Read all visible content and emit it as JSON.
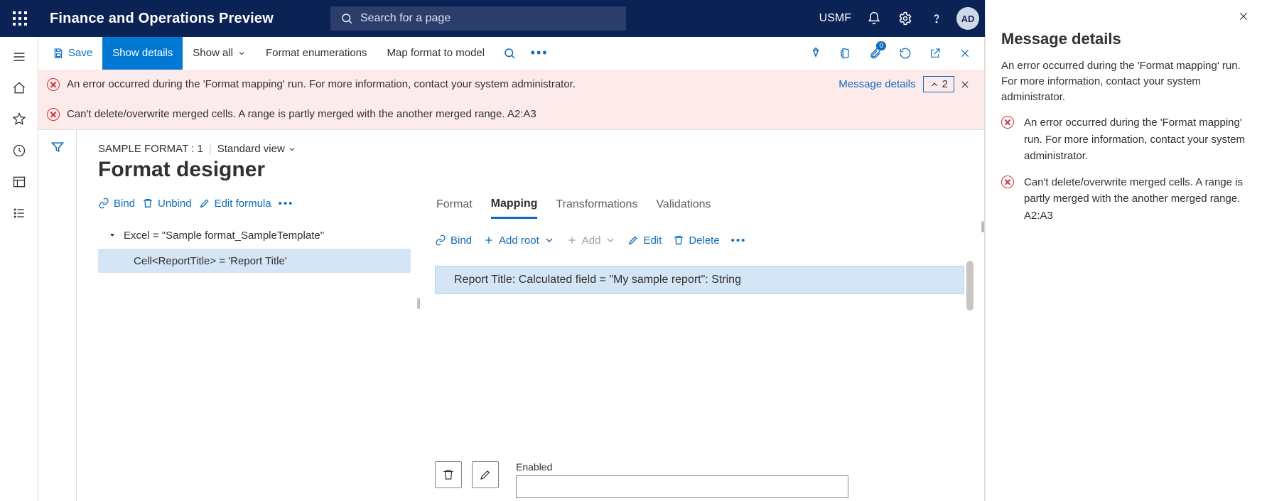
{
  "header": {
    "app_title": "Finance and Operations Preview",
    "search_placeholder": "Search for a page",
    "company_code": "USMF",
    "avatar_initials": "AD"
  },
  "actionbar": {
    "save": "Save",
    "show_details": "Show details",
    "show_all": "Show all",
    "format_enum": "Format enumerations",
    "map_to_model": "Map format to model",
    "attachment_badge": "0"
  },
  "messages": {
    "details_link": "Message details",
    "count": "2",
    "rows": [
      "An error occurred during the 'Format mapping' run. For more information, contact your system administrator.",
      "Can't delete/overwrite merged cells. A range is partly merged with the another merged range. A2:A3"
    ]
  },
  "page": {
    "breadcrumb": "SAMPLE FORMAT : 1",
    "view": "Standard view",
    "title": "Format designer"
  },
  "left_toolbar": {
    "bind": "Bind",
    "unbind": "Unbind",
    "edit_formula": "Edit formula"
  },
  "tree": {
    "root": "Excel = \"Sample format_SampleTemplate\"",
    "child": "Cell<ReportTitle> = 'Report Title'"
  },
  "tabs": {
    "format": "Format",
    "mapping": "Mapping",
    "transformations": "Transformations",
    "validations": "Validations"
  },
  "right_toolbar": {
    "bind": "Bind",
    "add_root": "Add root",
    "add": "Add",
    "edit": "Edit",
    "delete": "Delete"
  },
  "mapping_row": "Report Title: Calculated field = \"My sample report\": String",
  "bottom": {
    "enabled_label": "Enabled"
  },
  "rightpanel": {
    "title": "Message details",
    "paragraph": "An error occurred during the 'Format mapping' run. For more information, contact your system administrator.",
    "items": [
      "An error occurred during the 'Format mapping' run. For more information, contact your system administrator.",
      "Can't delete/overwrite merged cells. A range is partly merged with the another merged range. A2:A3"
    ]
  }
}
